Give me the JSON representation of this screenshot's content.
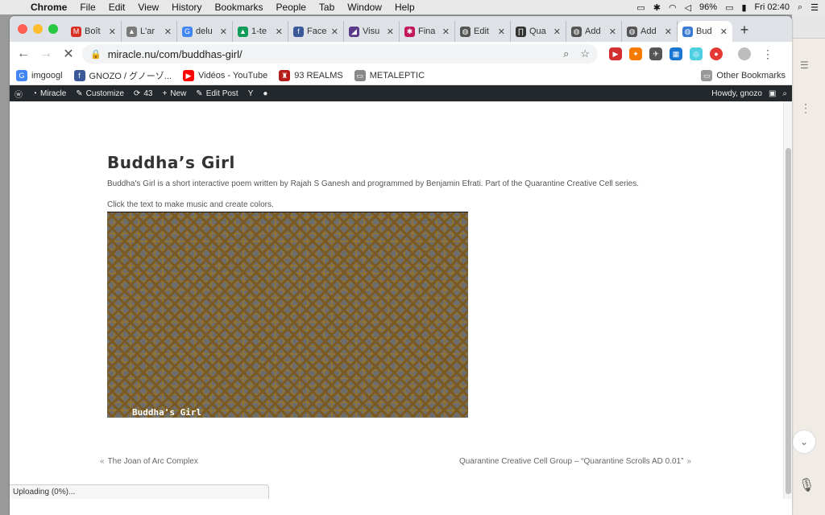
{
  "menubar": {
    "app": "Chrome",
    "items": [
      "File",
      "Edit",
      "View",
      "History",
      "Bookmarks",
      "People",
      "Tab",
      "Window",
      "Help"
    ],
    "battery": "96%",
    "clock": "Fri 02:40"
  },
  "tabs": [
    {
      "label": "Boît",
      "color": "#d93025",
      "glyph": "M"
    },
    {
      "label": "L'ar",
      "color": "#7a7a7a",
      "glyph": "▲"
    },
    {
      "label": "delu",
      "color": "#4285f4",
      "glyph": "G"
    },
    {
      "label": "1-te",
      "color": "#0f9d58",
      "glyph": "▲"
    },
    {
      "label": "Face",
      "color": "#3b5998",
      "glyph": "f"
    },
    {
      "label": "Visu",
      "color": "#5b3a8c",
      "glyph": "◢"
    },
    {
      "label": "Fina",
      "color": "#c2185b",
      "glyph": "✱"
    },
    {
      "label": "Edit",
      "color": "#555555",
      "glyph": "◍"
    },
    {
      "label": "Qua",
      "color": "#333333",
      "glyph": "∏"
    },
    {
      "label": "Add",
      "color": "#555555",
      "glyph": "◍"
    },
    {
      "label": "Add",
      "color": "#555555",
      "glyph": "◍"
    }
  ],
  "active_tab": {
    "label": "Bud",
    "color": "#3a7bd5",
    "glyph": "◍"
  },
  "address": {
    "url": "miracle.nu/com/buddhas-girl/"
  },
  "bookmarks": [
    {
      "label": "imgoogl",
      "color": "#4285f4",
      "glyph": "G"
    },
    {
      "label": "GNOZO / グノーゾ...",
      "color": "#3b5998",
      "glyph": "f"
    },
    {
      "label": "Vidéos - YouTube",
      "color": "#ff0000",
      "glyph": "▶"
    },
    {
      "label": "93 REALMS",
      "color": "#b71c1c",
      "glyph": "♜"
    },
    {
      "label": "METALEPTIC",
      "color": "#888888",
      "glyph": "▭"
    }
  ],
  "other_bookmarks": "Other Bookmarks",
  "wpbar": {
    "site": "Miracle",
    "customize": "Customize",
    "updates": "43",
    "new": "New",
    "edit_post": "Edit Post",
    "howdy": "Howdy, gnozo"
  },
  "post": {
    "title": "Buddha’s Girl",
    "description": "Buddha's Girl is a short interactive poem written by Rajah S Ganesh and programmed by Benjamin Efrati. Part of the Quarantine Creative Cell series.",
    "instruction": "Click the text to make music and create colors.",
    "canvas_label": "Buddha's Girl"
  },
  "postnav": {
    "prev": "The Joan of Arc Complex",
    "next": "Quarantine Creative Cell Group – “Quarantine Scrolls AD 0.01”"
  },
  "status": "Uploading (0%)..."
}
